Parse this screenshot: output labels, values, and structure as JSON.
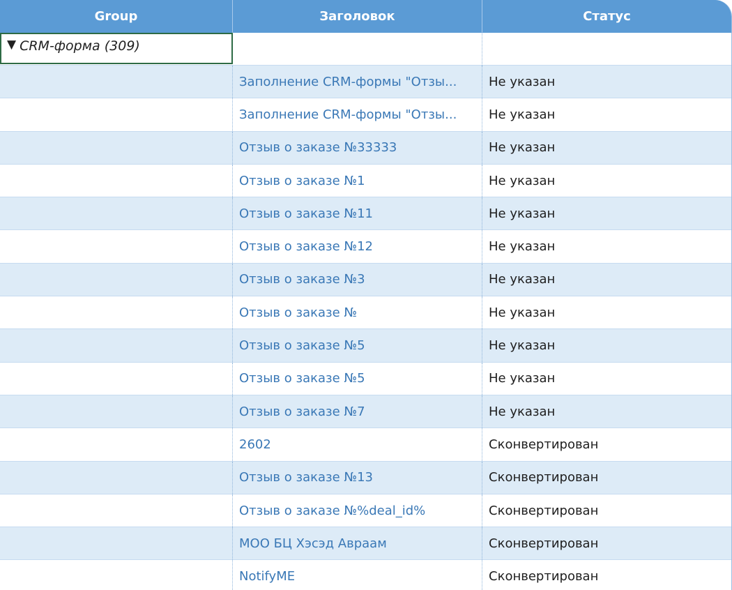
{
  "columns": {
    "group": "Group",
    "title": "Заголовок",
    "status": "Статус"
  },
  "group": {
    "toggle_icon": "▼",
    "label": "CRM-форма (309)"
  },
  "rows": [
    {
      "title": "Заполнение CRM-формы \"Отзы...",
      "status": "Не указан"
    },
    {
      "title": "Заполнение CRM-формы \"Отзы...",
      "status": "Не указан"
    },
    {
      "title": "Отзыв о заказе №33333",
      "status": "Не указан"
    },
    {
      "title": "Отзыв о заказе №1",
      "status": "Не указан"
    },
    {
      "title": "Отзыв о заказе №11",
      "status": "Не указан"
    },
    {
      "title": "Отзыв о заказе №12",
      "status": "Не указан"
    },
    {
      "title": "Отзыв о заказе №3",
      "status": "Не указан"
    },
    {
      "title": "Отзыв о заказе №",
      "status": "Не указан"
    },
    {
      "title": "Отзыв о заказе №5",
      "status": "Не указан"
    },
    {
      "title": "Отзыв о заказе №5",
      "status": "Не указан"
    },
    {
      "title": "Отзыв о заказе №7",
      "status": "Не указан"
    },
    {
      "title": "2602",
      "status": "Сконвертирован"
    },
    {
      "title": "Отзыв о заказе №13",
      "status": "Сконвертирован"
    },
    {
      "title": "Отзыв о заказе №%deal_id%",
      "status": "Сконвертирован"
    },
    {
      "title": "МОО БЦ Хэсэд Авраам",
      "status": "Сконвертирован"
    },
    {
      "title": "NotifyME",
      "status": "Сконвертирован"
    }
  ],
  "colors": {
    "header_bg": "#5b9bd5",
    "alt_row_bg": "#ddebf7",
    "link_text": "#3a78b6",
    "selection_border": "#2e6b45"
  }
}
